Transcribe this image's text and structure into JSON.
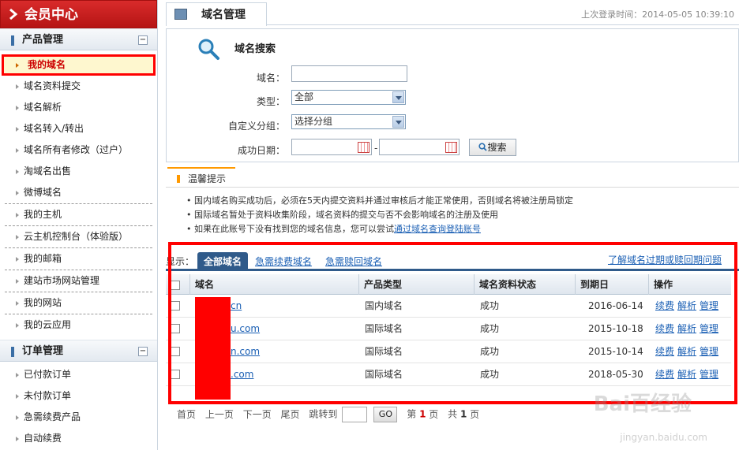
{
  "sidebar": {
    "title": "会员中心",
    "sections": [
      {
        "label": "产品管理",
        "toggle": "−"
      },
      {
        "label": "订单管理",
        "toggle": "−"
      }
    ],
    "group1": [
      "我的域名",
      "域名资料提交",
      "域名解析",
      "域名转入/转出",
      "域名所有者修改（过户）",
      "淘域名出售",
      "微博域名"
    ],
    "group2": [
      "我的主机",
      "云主机控制台（体验版）",
      "我的邮箱",
      "建站市场网站管理",
      "我的网站",
      "我的云应用"
    ],
    "group3": [
      "已付款订单",
      "未付款订单",
      "急需续费产品",
      "自动续费"
    ]
  },
  "header": {
    "tab": "域名管理",
    "last_login": "上次登录时间：2014-05-05 10:39:10"
  },
  "search": {
    "title": "域名搜索",
    "domain_label": "域名：",
    "type_label": "类型：",
    "type_value": "全部",
    "group_label": "自定义分组：",
    "group_value": "选择分组",
    "date_label": "成功日期：",
    "date_sep": "-",
    "button": "搜索"
  },
  "tips": {
    "title": "温馨提示",
    "line1": "• 国内域名购买成功后，必须在5天内提交资料并通过审核后才能正常使用，否则域名将被注册局锁定",
    "line2": "• 国际域名暂处于资料收集阶段，域名资料的提交与否不会影响域名的注册及使用",
    "line3_pre": "• 如果在此账号下没有找到您的域名信息，您可以尝试",
    "line3_link": "通过域名查询登陆账号"
  },
  "list": {
    "prefix": "显示：",
    "tabs": [
      "全部域名",
      "急需续费域名",
      "急需赎回域名"
    ],
    "help": "了解域名过期或赎回期问题",
    "headers": [
      "域名",
      "产品类型",
      "域名资料状态",
      "到期日",
      "操作"
    ],
    "rows": [
      {
        "domain": "cn",
        "type": "国内域名",
        "status": "成功",
        "expire": "2016-06-14"
      },
      {
        "domain": "u.com",
        "type": "国际域名",
        "status": "成功",
        "expire": "2015-10-18"
      },
      {
        "domain": "n.com",
        "type": "国际域名",
        "status": "成功",
        "expire": "2015-10-14"
      },
      {
        "domain": ".com",
        "type": "国际域名",
        "status": "成功",
        "expire": "2018-05-30"
      }
    ],
    "actions": [
      "续费",
      "解析",
      "管理"
    ]
  },
  "pager": {
    "first": "首页",
    "prev": "上一页",
    "next": "下一页",
    "last": "尾页",
    "jump": "跳转到",
    "go": "GO",
    "page_pre": "第",
    "page_num": "1",
    "page_post": "页",
    "total_pre": "共",
    "total_num": "1",
    "total_post": "页"
  },
  "watermark": {
    "brand": "Bai百经验",
    "url": "jingyan.baidu.com"
  },
  "colors": {
    "accent": "#2f5a8a",
    "highlight": "#ff0000",
    "link": "#1a5fb4"
  }
}
